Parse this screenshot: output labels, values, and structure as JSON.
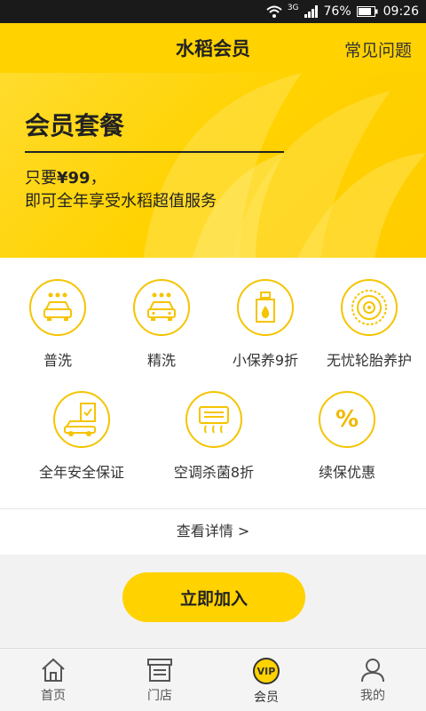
{
  "status_bar": {
    "network": "3G",
    "battery": "76%",
    "time": "09:26"
  },
  "header": {
    "title": "水稻会员",
    "right_link": "常见问题"
  },
  "banner": {
    "title": "会员套餐",
    "line1_prefix": "只要",
    "line1_price": "¥99",
    "line1_suffix": "，",
    "line2": "即可全年享受水稻超值服务"
  },
  "features": [
    {
      "label": "普洗",
      "icon": "car-wash-icon"
    },
    {
      "label": "精洗",
      "icon": "car-fine-wash-icon"
    },
    {
      "label": "小保养9折",
      "icon": "oil-bottle-icon"
    },
    {
      "label": "无忧轮胎养护",
      "icon": "tire-icon"
    },
    {
      "label": "全年安全保证",
      "icon": "car-insurance-icon"
    },
    {
      "label": "空调杀菌8折",
      "icon": "air-conditioner-icon"
    },
    {
      "label": "续保优惠",
      "icon": "percent-icon",
      "glyph": "%"
    }
  ],
  "detail_link": "查看详情 >",
  "join_button": "立即加入",
  "tabs": [
    {
      "label": "首页",
      "icon": "home-icon"
    },
    {
      "label": "门店",
      "icon": "store-icon"
    },
    {
      "label": "会员",
      "icon": "vip-icon",
      "badge": "VIP",
      "active": true
    },
    {
      "label": "我的",
      "icon": "user-icon"
    }
  ],
  "colors": {
    "accent": "#ffd200",
    "icon_stroke": "#f5c400",
    "status_bar": "#1a1a1a"
  }
}
